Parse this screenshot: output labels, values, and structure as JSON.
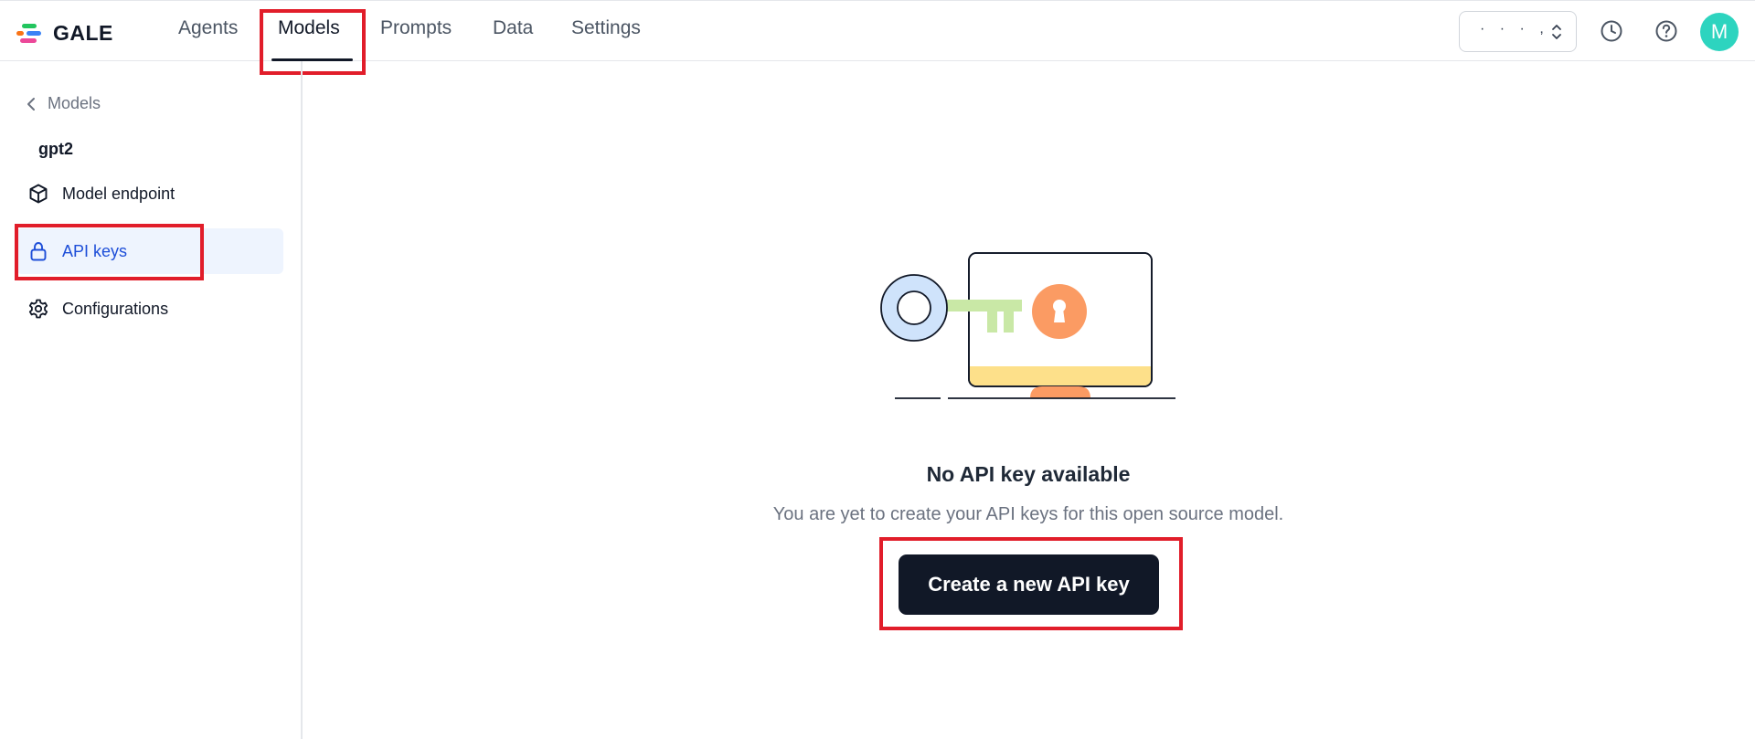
{
  "app": {
    "logo_text": "GALE"
  },
  "nav": {
    "tabs": [
      {
        "label": "Agents"
      },
      {
        "label": "Models"
      },
      {
        "label": "Prompts"
      },
      {
        "label": "Data"
      },
      {
        "label": "Settings"
      }
    ],
    "active_tab": "Models"
  },
  "header": {
    "workspace_selector_value": "· · · ,",
    "avatar_initial": "M",
    "icons": [
      "history-icon",
      "help-icon"
    ]
  },
  "sidebar": {
    "back_label": "Models",
    "model_name": "gpt2",
    "items": [
      {
        "label": "Model endpoint",
        "icon": "cube-icon"
      },
      {
        "label": "API keys",
        "icon": "lock-icon"
      },
      {
        "label": "Configurations",
        "icon": "gear-icon"
      }
    ],
    "active_item": "API keys"
  },
  "main": {
    "empty_title": "No API key available",
    "empty_subtitle": "You are yet to create your API keys for this open source model.",
    "create_button_label": "Create a new API key"
  },
  "colors": {
    "accent": "#1d4ed8",
    "avatar": "#2dd4bf",
    "primary_button": "#111827",
    "highlight_box": "#e11d2a"
  }
}
